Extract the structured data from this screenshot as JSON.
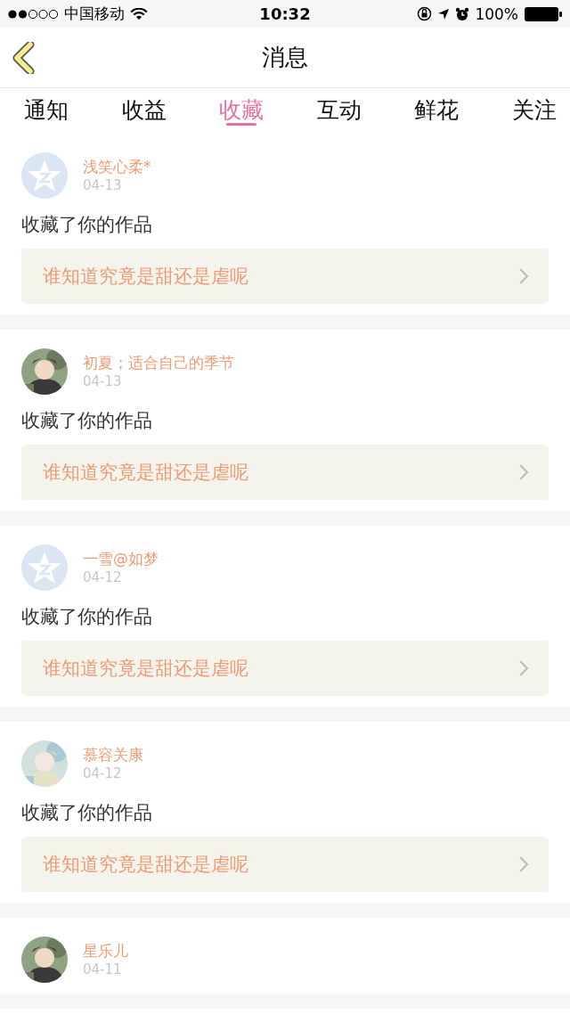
{
  "status_bar": {
    "carrier": "中国移动",
    "time": "10:32",
    "battery": "100%"
  },
  "nav": {
    "title": "消息"
  },
  "tabs": [
    {
      "label": "通知",
      "selected": false
    },
    {
      "label": "收益",
      "selected": false
    },
    {
      "label": "收藏",
      "selected": true
    },
    {
      "label": "互动",
      "selected": false
    },
    {
      "label": "鲜花",
      "selected": false
    },
    {
      "label": "关注",
      "selected": false
    }
  ],
  "messages": [
    {
      "avatar": {
        "kind": "default"
      },
      "name": "浅笑心柔*",
      "date": "04-13",
      "action": "收藏了你的作品",
      "work": "谁知道究竟是甜还是虐呢"
    },
    {
      "name": "初夏；适合自己的季节",
      "date": "04-13",
      "action": "收藏了你的作品",
      "work": "谁知道究竟是甜还是虐呢"
    },
    {
      "avatar": {
        "kind": "default"
      },
      "name": "一雪@如梦",
      "date": "04-12",
      "action": "收藏了你的作品",
      "work": "谁知道究竟是甜还是虐呢"
    },
    {
      "name": "慕容关康",
      "date": "04-12",
      "action": "收藏了你的作品",
      "work": "谁知道究竟是甜还是虐呢"
    },
    {
      "name": "星乐儿",
      "date": "04-11"
    }
  ]
}
